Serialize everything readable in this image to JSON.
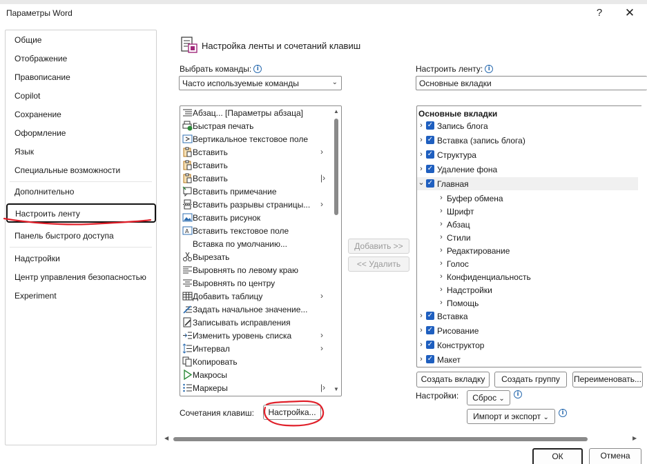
{
  "window": {
    "title": "Параметры Word",
    "help": "?",
    "close": "✕"
  },
  "nav": {
    "items": [
      "Общие",
      "Отображение",
      "Правописание",
      "Copilot",
      "Сохранение",
      "Оформление",
      "Язык",
      "Специальные возможности",
      "Дополнительно",
      "Настроить ленту",
      "Панель быстрого доступа",
      "Надстройки",
      "Центр управления безопасностью",
      "Experiment"
    ],
    "selected": "Настроить ленту"
  },
  "header": {
    "title": "Настройка ленты и сочетаний клавиш"
  },
  "choose_commands": {
    "label": "Выбрать команды:",
    "value": "Часто используемые команды"
  },
  "customize_ribbon": {
    "label": "Настроить ленту:",
    "value": "Основные вкладки"
  },
  "commands": [
    {
      "label": "Абзац... [Параметры абзаца]",
      "icon": "paragraph-icon",
      "sub": ""
    },
    {
      "label": "Быстрая печать",
      "icon": "quick-print-icon",
      "sub": ""
    },
    {
      "label": "Вертикальное текстовое поле",
      "icon": "vertical-textbox-icon",
      "sub": ""
    },
    {
      "label": "Вставить",
      "icon": "paste-icon",
      "sub": "›"
    },
    {
      "label": "Вставить",
      "icon": "paste-icon",
      "sub": ""
    },
    {
      "label": "Вставить",
      "icon": "paste-icon",
      "sub": "|›"
    },
    {
      "label": "Вставить примечание",
      "icon": "comment-icon",
      "sub": ""
    },
    {
      "label": "Вставить разрывы страницы...",
      "icon": "page-break-icon",
      "sub": "›"
    },
    {
      "label": "Вставить рисунок",
      "icon": "picture-icon",
      "sub": ""
    },
    {
      "label": "Вставить текстовое поле",
      "icon": "textbox-icon",
      "sub": ""
    },
    {
      "label": "Вставка по умолчанию...",
      "icon": "",
      "sub": ""
    },
    {
      "label": "Вырезать",
      "icon": "scissors-icon",
      "sub": ""
    },
    {
      "label": "Выровнять по левому краю",
      "icon": "align-left-icon",
      "sub": ""
    },
    {
      "label": "Выровнять по центру",
      "icon": "align-center-icon",
      "sub": ""
    },
    {
      "label": "Добавить таблицу",
      "icon": "table-icon",
      "sub": "›"
    },
    {
      "label": "Задать начальное значение...",
      "icon": "numbering-value-icon",
      "sub": ""
    },
    {
      "label": "Записывать исправления",
      "icon": "track-changes-icon",
      "sub": ""
    },
    {
      "label": "Изменить уровень списка",
      "icon": "list-level-icon",
      "sub": "›"
    },
    {
      "label": "Интервал",
      "icon": "spacing-icon",
      "sub": "›"
    },
    {
      "label": "Копировать",
      "icon": "copy-icon",
      "sub": ""
    },
    {
      "label": "Макросы",
      "icon": "macro-icon",
      "sub": ""
    },
    {
      "label": "Маркеры",
      "icon": "bullets-icon",
      "sub": "|›"
    }
  ],
  "middle": {
    "add": "Добавить >>",
    "remove": "<< Удалить"
  },
  "tree": {
    "header": "Основные вкладки",
    "items": [
      {
        "label": "Запись блога",
        "level": 0,
        "checked": true,
        "chev": "›"
      },
      {
        "label": "Вставка (запись блога)",
        "level": 0,
        "checked": true,
        "chev": "›"
      },
      {
        "label": "Структура",
        "level": 0,
        "checked": true,
        "chev": "›"
      },
      {
        "label": "Удаление фона",
        "level": 0,
        "checked": true,
        "chev": "›"
      },
      {
        "label": "Главная",
        "level": 0,
        "checked": true,
        "chev": "⌄"
      },
      {
        "label": "Буфер обмена",
        "level": 1,
        "checked": false,
        "chev": "›"
      },
      {
        "label": "Шрифт",
        "level": 1,
        "checked": false,
        "chev": "›"
      },
      {
        "label": "Абзац",
        "level": 1,
        "checked": false,
        "chev": "›"
      },
      {
        "label": "Стили",
        "level": 1,
        "checked": false,
        "chev": "›"
      },
      {
        "label": "Редактирование",
        "level": 1,
        "checked": false,
        "chev": "›"
      },
      {
        "label": "Голос",
        "level": 1,
        "checked": false,
        "chev": "›"
      },
      {
        "label": "Конфиденциальность",
        "level": 1,
        "checked": false,
        "chev": "›"
      },
      {
        "label": "Надстройки",
        "level": 1,
        "checked": false,
        "chev": "›"
      },
      {
        "label": "Помощь",
        "level": 1,
        "checked": false,
        "chev": "›"
      },
      {
        "label": "Вставка",
        "level": 0,
        "checked": true,
        "chev": "›"
      },
      {
        "label": "Рисование",
        "level": 0,
        "checked": true,
        "chev": "›"
      },
      {
        "label": "Конструктор",
        "level": 0,
        "checked": true,
        "chev": "›"
      },
      {
        "label": "Макет",
        "level": 0,
        "checked": true,
        "chev": "›"
      }
    ]
  },
  "tree_buttons": {
    "new_tab": "Создать вкладку",
    "new_group": "Создать группу",
    "rename": "Переименовать..."
  },
  "settings": {
    "label": "Настройки:",
    "reset": "Сброс",
    "import_export": "Импорт и экспорт"
  },
  "shortcuts": {
    "label": "Сочетания клавиш:",
    "button": "Настройка..."
  },
  "footer": {
    "ok": "ОК",
    "cancel": "Отмена"
  },
  "colors": {
    "checkbox": "#1f5fbf",
    "annotation": "#e0202a",
    "info": "#2b6cb0"
  }
}
